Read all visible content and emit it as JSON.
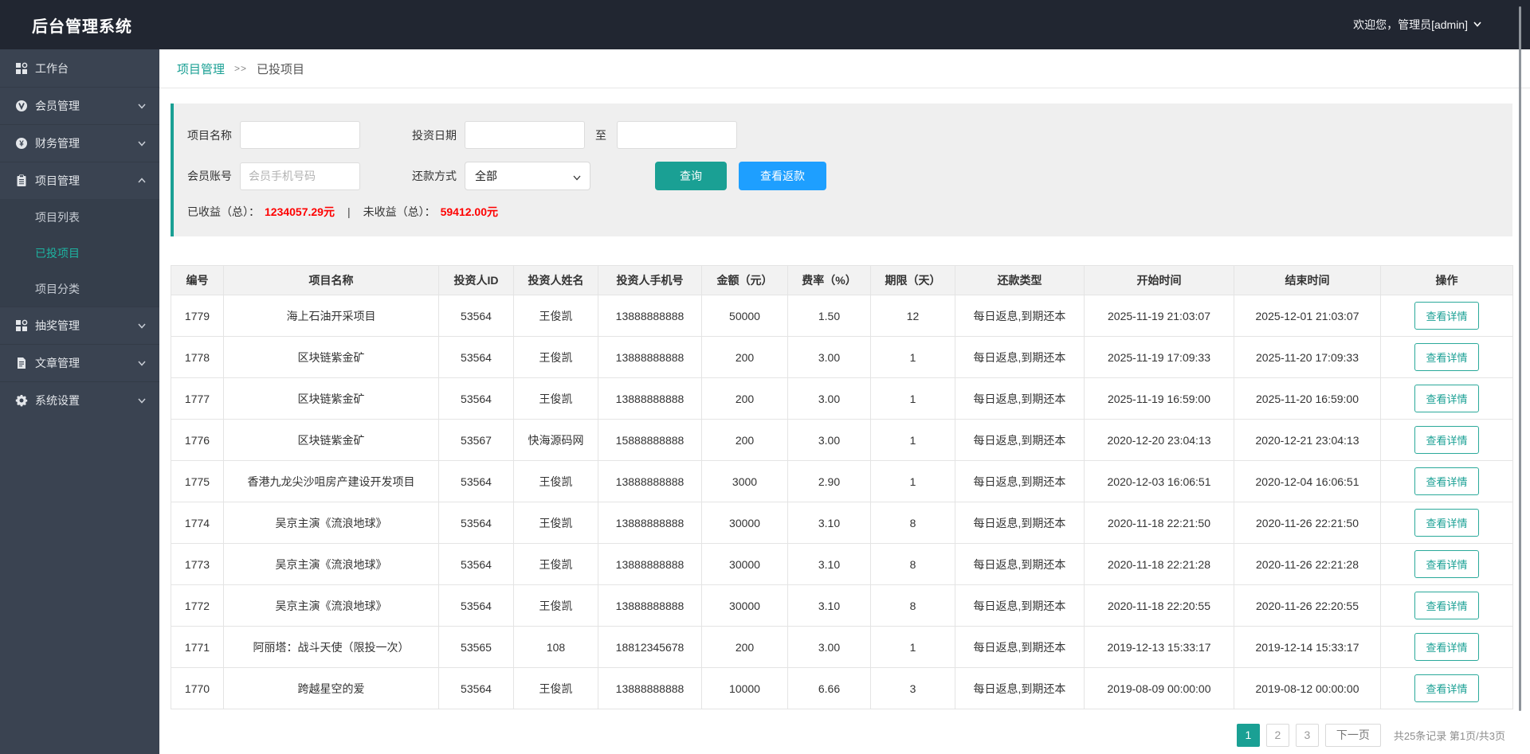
{
  "header": {
    "title": "后台管理系统",
    "welcome": "欢迎您，管理员[admin]"
  },
  "sidebar": {
    "items": [
      {
        "label": "工作台",
        "icon": "grid-icon",
        "chevron": null
      },
      {
        "label": "会员管理",
        "icon": "member-icon",
        "chevron": "down"
      },
      {
        "label": "财务管理",
        "icon": "finance-icon",
        "chevron": "down"
      },
      {
        "label": "项目管理",
        "icon": "clipboard-icon",
        "chevron": "up",
        "children": [
          {
            "label": "项目列表",
            "active": false
          },
          {
            "label": "已投项目",
            "active": true
          },
          {
            "label": "项目分类",
            "active": false
          }
        ]
      },
      {
        "label": "抽奖管理",
        "icon": "grid-icon",
        "chevron": "down"
      },
      {
        "label": "文章管理",
        "icon": "article-icon",
        "chevron": "down"
      },
      {
        "label": "系统设置",
        "icon": "gear-icon",
        "chevron": "down"
      }
    ]
  },
  "breadcrumb": {
    "parent": "项目管理",
    "separator": ">>",
    "current": "已投项目"
  },
  "filter": {
    "project_name_label": "项目名称",
    "invest_date_label": "投资日期",
    "to_label": "至",
    "member_account_label": "会员账号",
    "member_account_placeholder": "会员手机号码",
    "repayment_label": "还款方式",
    "repayment_selected": "全部",
    "search_button": "查询",
    "view_refund_button": "查看返款",
    "earned_label": "已收益（总）：",
    "earned_value": "1234057.29元",
    "pipe": "|",
    "unearned_label": "未收益（总）：",
    "unearned_value": "59412.00元"
  },
  "table": {
    "columns": [
      "编号",
      "项目名称",
      "投资人ID",
      "投资人姓名",
      "投资人手机号",
      "金额（元）",
      "费率（%）",
      "期限（天）",
      "还款类型",
      "开始时间",
      "结束时间",
      "操作"
    ],
    "action_label": "查看详情",
    "rows": [
      {
        "id": "1779",
        "project_name": "海上石油开采项目",
        "investor_id": "53564",
        "investor_name": "王俊凯",
        "investor_phone": "13888888888",
        "amount": "50000",
        "rate": "1.50",
        "term_days": "12",
        "repay_type": "每日返息,到期还本",
        "start_time": "2025-11-19 21:03:07",
        "end_time": "2025-12-01 21:03:07"
      },
      {
        "id": "1778",
        "project_name": "区块链紫金矿",
        "investor_id": "53564",
        "investor_name": "王俊凯",
        "investor_phone": "13888888888",
        "amount": "200",
        "rate": "3.00",
        "term_days": "1",
        "repay_type": "每日返息,到期还本",
        "start_time": "2025-11-19 17:09:33",
        "end_time": "2025-11-20 17:09:33"
      },
      {
        "id": "1777",
        "project_name": "区块链紫金矿",
        "investor_id": "53564",
        "investor_name": "王俊凯",
        "investor_phone": "13888888888",
        "amount": "200",
        "rate": "3.00",
        "term_days": "1",
        "repay_type": "每日返息,到期还本",
        "start_time": "2025-11-19 16:59:00",
        "end_time": "2025-11-20 16:59:00"
      },
      {
        "id": "1776",
        "project_name": "区块链紫金矿",
        "investor_id": "53567",
        "investor_name": "快海源码网",
        "investor_phone": "15888888888",
        "amount": "200",
        "rate": "3.00",
        "term_days": "1",
        "repay_type": "每日返息,到期还本",
        "start_time": "2020-12-20 23:04:13",
        "end_time": "2020-12-21 23:04:13"
      },
      {
        "id": "1775",
        "project_name": "香港九龙尖沙咀房产建设开发项目",
        "investor_id": "53564",
        "investor_name": "王俊凯",
        "investor_phone": "13888888888",
        "amount": "3000",
        "rate": "2.90",
        "term_days": "1",
        "repay_type": "每日返息,到期还本",
        "start_time": "2020-12-03 16:06:51",
        "end_time": "2020-12-04 16:06:51"
      },
      {
        "id": "1774",
        "project_name": "吴京主演《流浪地球》",
        "investor_id": "53564",
        "investor_name": "王俊凯",
        "investor_phone": "13888888888",
        "amount": "30000",
        "rate": "3.10",
        "term_days": "8",
        "repay_type": "每日返息,到期还本",
        "start_time": "2020-11-18 22:21:50",
        "end_time": "2020-11-26 22:21:50"
      },
      {
        "id": "1773",
        "project_name": "吴京主演《流浪地球》",
        "investor_id": "53564",
        "investor_name": "王俊凯",
        "investor_phone": "13888888888",
        "amount": "30000",
        "rate": "3.10",
        "term_days": "8",
        "repay_type": "每日返息,到期还本",
        "start_time": "2020-11-18 22:21:28",
        "end_time": "2020-11-26 22:21:28"
      },
      {
        "id": "1772",
        "project_name": "吴京主演《流浪地球》",
        "investor_id": "53564",
        "investor_name": "王俊凯",
        "investor_phone": "13888888888",
        "amount": "30000",
        "rate": "3.10",
        "term_days": "8",
        "repay_type": "每日返息,到期还本",
        "start_time": "2020-11-18 22:20:55",
        "end_time": "2020-11-26 22:20:55"
      },
      {
        "id": "1771",
        "project_name": "阿丽塔：战斗天使（限投一次）",
        "investor_id": "53565",
        "investor_name": "108",
        "investor_phone": "18812345678",
        "amount": "200",
        "rate": "3.00",
        "term_days": "1",
        "repay_type": "每日返息,到期还本",
        "start_time": "2019-12-13 15:33:17",
        "end_time": "2019-12-14 15:33:17"
      },
      {
        "id": "1770",
        "project_name": "跨越星空的爱",
        "investor_id": "53564",
        "investor_name": "王俊凯",
        "investor_phone": "13888888888",
        "amount": "10000",
        "rate": "6.66",
        "term_days": "3",
        "repay_type": "每日返息,到期还本",
        "start_time": "2019-08-09 00:00:00",
        "end_time": "2019-08-12 00:00:00"
      }
    ]
  },
  "pagination": {
    "pages": [
      "1",
      "2",
      "3"
    ],
    "active_page": "1",
    "next_label": "下一页",
    "info": "共25条记录 第1页/共3页"
  },
  "colors": {
    "accent_teal": "#1aa094",
    "accent_blue": "#1e9fff",
    "danger_red": "#fe0000",
    "header_bg": "#212631",
    "sidebar_bg": "#3a4351"
  }
}
